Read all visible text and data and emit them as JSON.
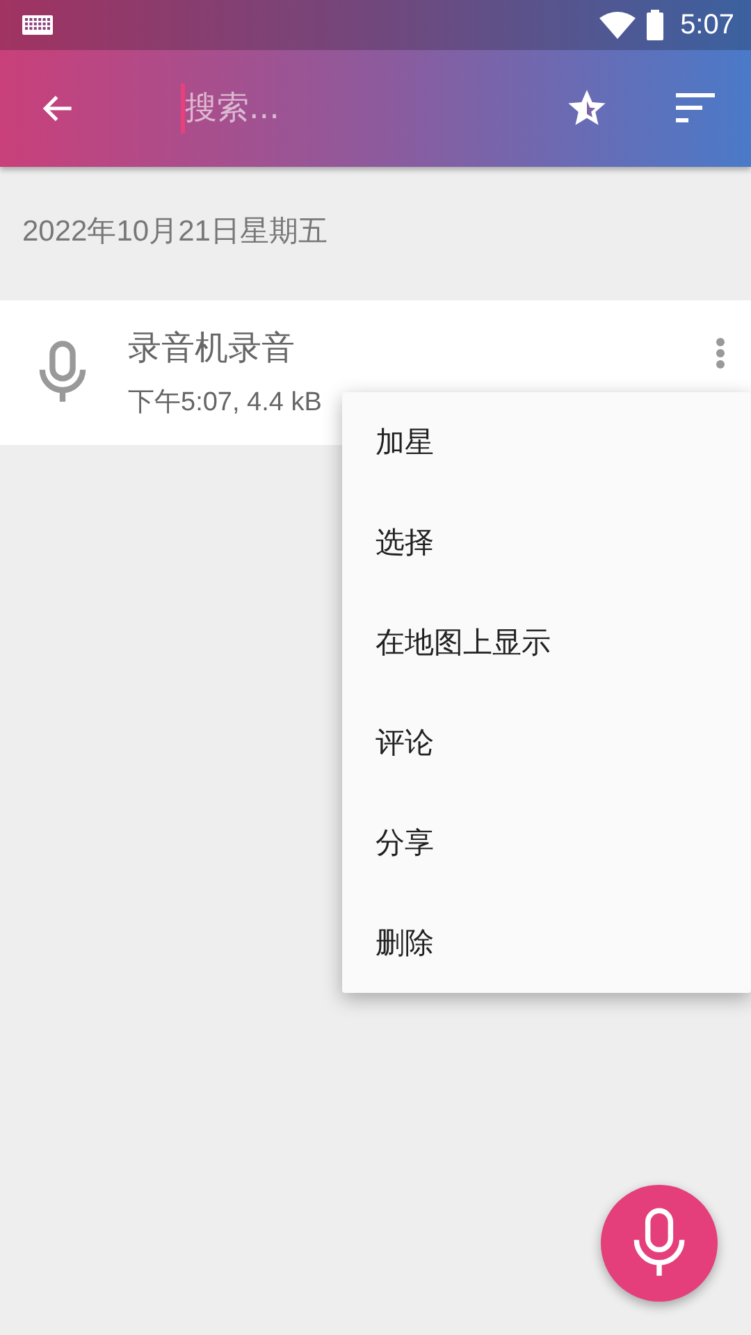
{
  "status_bar": {
    "time": "5:07"
  },
  "toolbar": {
    "search": {
      "placeholder": "搜索..."
    }
  },
  "date_header": "2022年10月21日星期五",
  "recordings": [
    {
      "title": "录音机录音",
      "details": "下午5:07, 4.4 kB"
    }
  ],
  "context_menu": [
    "加星",
    "选择",
    "在地图上显示",
    "评论",
    "分享",
    "删除"
  ]
}
